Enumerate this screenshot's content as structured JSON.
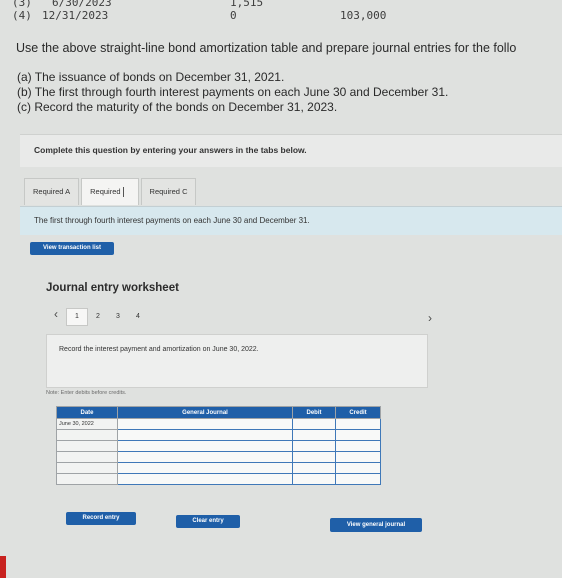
{
  "top_table": {
    "row3": {
      "num": "(3)",
      "date": "6/30/2023",
      "col2": "1,515"
    },
    "row4": {
      "num": "(4)",
      "date": "12/31/2023",
      "col2": "0",
      "col3": "103,000"
    }
  },
  "problem": {
    "intro": "Use the above straight-line bond amortization table and prepare journal entries for the follo",
    "items": [
      "(a) The issuance of bonds on December 31, 2021.",
      "(b) The first through fourth interest payments on each June 30 and December 31.",
      "(c) Record the maturity of the bonds on December 31, 2023."
    ]
  },
  "banner": "Complete this question by entering your answers in the tabs below.",
  "tabs": [
    {
      "label": "Required A",
      "active": false
    },
    {
      "label": "Required",
      "active": true
    },
    {
      "label": "Required C",
      "active": false
    }
  ],
  "tab_description": "The first through fourth interest payments on each June 30 and December 31.",
  "view_transaction_list": "View transaction list",
  "worksheet": {
    "title": "Journal entry worksheet",
    "prev_icon": "chevron-left-icon",
    "next_icon": "chevron-right-icon",
    "pages": [
      "1",
      "2",
      "3",
      "4"
    ],
    "active_page": "1",
    "instruction": "Record the interest payment and amortization on June 30, 2022.",
    "note": "Note: Enter debits before credits.",
    "table": {
      "headers": {
        "date": "Date",
        "account": "General Journal",
        "debit": "Debit",
        "credit": "Credit"
      },
      "date_value": "June 30, 2022",
      "row_count": 6
    },
    "buttons": {
      "record": "Record entry",
      "clear": "Clear entry",
      "view_general": "View general journal"
    }
  },
  "colors": {
    "accent_blue": "#1f5fa8",
    "tab_desc_bg": "#d7e8ee",
    "page_bg": "#dfe1df"
  }
}
